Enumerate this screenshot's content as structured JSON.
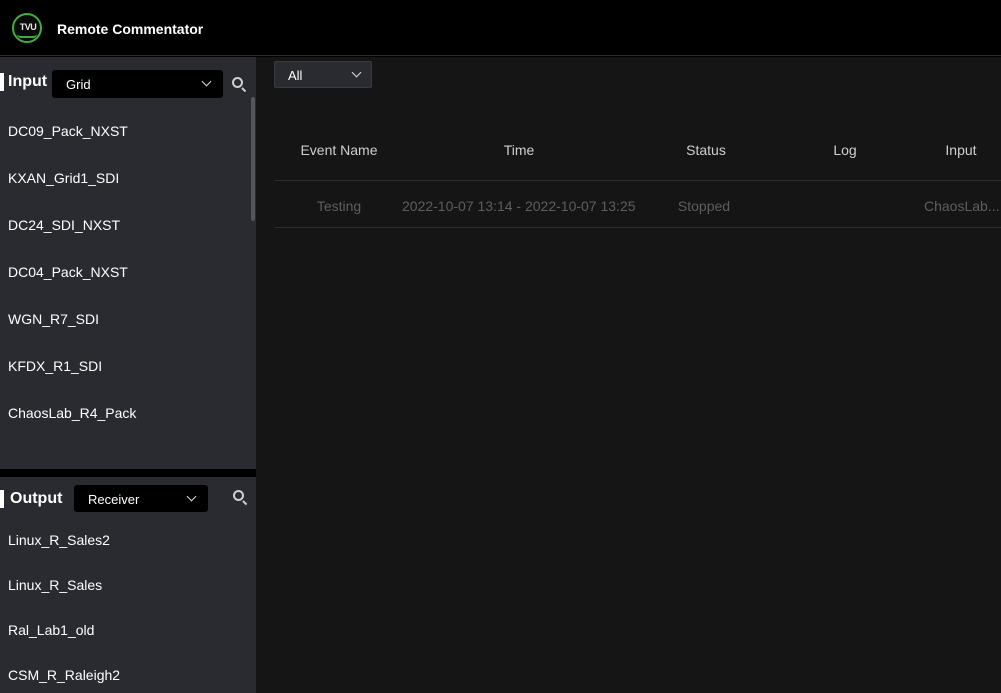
{
  "header": {
    "logo_text": "TVU",
    "app_title": "Remote Commentator"
  },
  "input_panel": {
    "title": "Input",
    "source_select": "Grid",
    "items": [
      "DC09_Pack_NXST",
      "KXAN_Grid1_SDI",
      "DC24_SDI_NXST",
      "DC04_Pack_NXST",
      "WGN_R7_SDI",
      "KFDX_R1_SDI",
      "ChaosLab_R4_Pack"
    ]
  },
  "output_panel": {
    "title": "Output",
    "source_select": "Receiver",
    "items": [
      "Linux_R_Sales2",
      "Linux_R_Sales",
      "Ral_Lab1_old",
      "CSM_R_Raleigh2"
    ]
  },
  "main": {
    "filter_select": "All",
    "table": {
      "columns": [
        "Event Name",
        "Time",
        "Status",
        "Log",
        "Input"
      ],
      "rows": [
        {
          "event_name": "Testing",
          "time": "2022-10-07 13:14 - 2022-10-07 13:25",
          "status": "Stopped",
          "log": "",
          "input": "ChaosLab..."
        }
      ]
    }
  }
}
